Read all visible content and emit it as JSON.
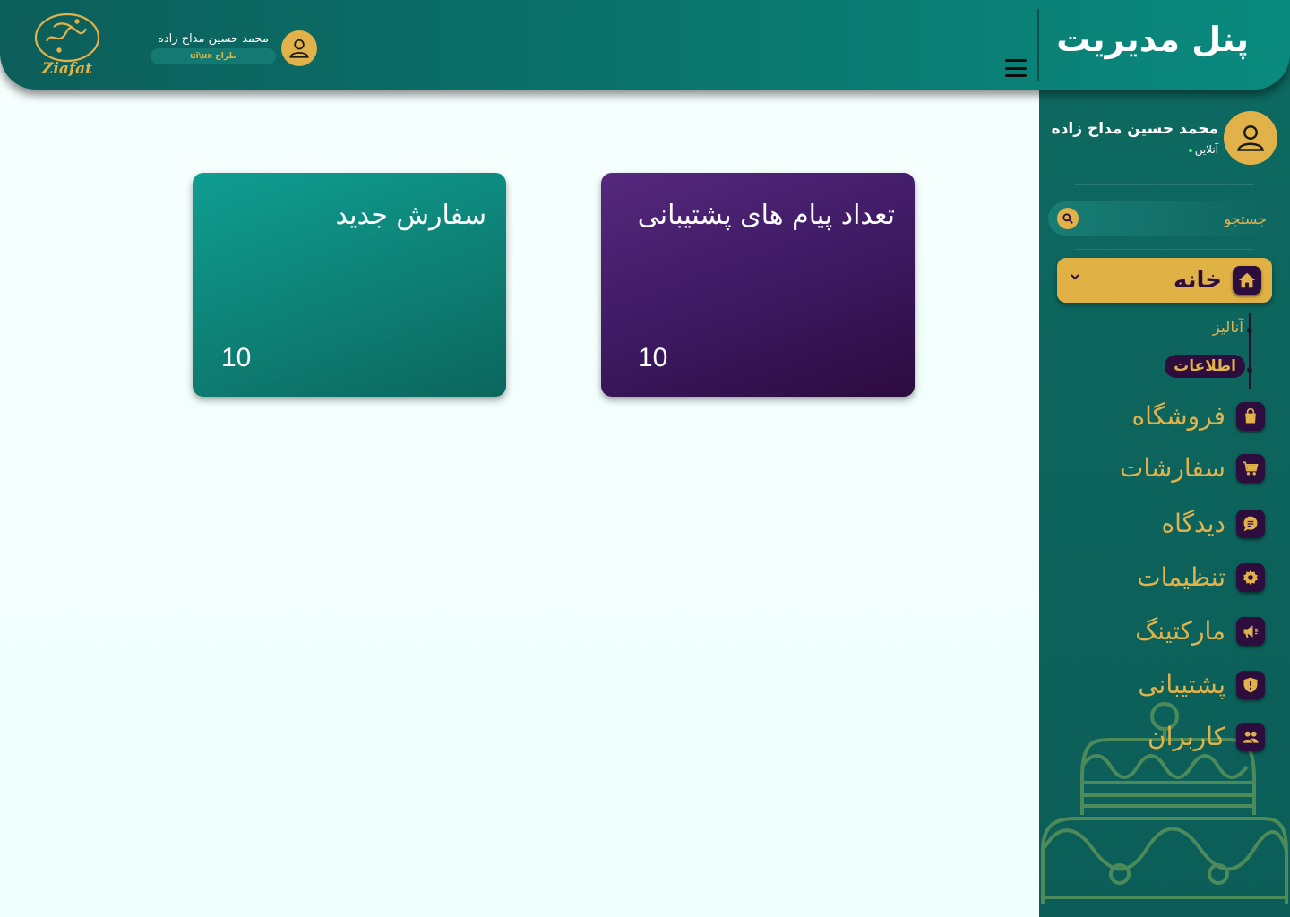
{
  "header": {
    "panel_title": "پنل مدیریت",
    "logo_text": "Ziafat",
    "user_name": "محمد حسین مداح زاده",
    "user_role": "طراح ui\\ux"
  },
  "sidebar": {
    "user_name": "محمد حسین مداح زاده",
    "user_status": "آنلاین",
    "search_placeholder": "جستجو",
    "home": {
      "label": "خانه",
      "subitems": [
        "آنالیز",
        "اطلاعات"
      ]
    },
    "items": [
      {
        "label": "فروشگاه",
        "icon": "bag-icon"
      },
      {
        "label": "سفارشات",
        "icon": "cart-icon"
      },
      {
        "label": "دیدگاه",
        "icon": "comment-icon"
      },
      {
        "label": "تنظیمات",
        "icon": "gear-icon"
      },
      {
        "label": "مارکتینگ",
        "icon": "megaphone-icon"
      },
      {
        "label": "پشتیبانی",
        "icon": "shield-icon"
      },
      {
        "label": "کاربران",
        "icon": "users-icon"
      }
    ]
  },
  "cards": {
    "support": {
      "title": "تعداد پیام های پشتیبانی",
      "value": "10"
    },
    "orders": {
      "title": "سفارش جدید",
      "value": "10"
    }
  },
  "colors": {
    "teal": "#0c6b63",
    "gold": "#e2b24a",
    "purple": "#2c0d3e"
  }
}
